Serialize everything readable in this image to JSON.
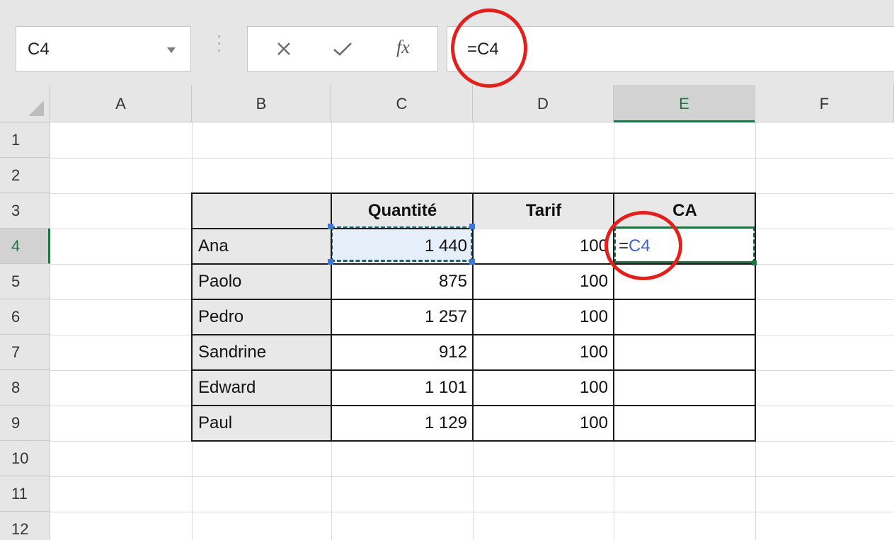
{
  "formula_bar": {
    "name_box": "C4",
    "cancel_icon": "close-icon",
    "enter_icon": "checkmark-icon",
    "function_icon": "fx-icon",
    "function_label": "fx",
    "formula": "=C4"
  },
  "columns": [
    "A",
    "B",
    "C",
    "D",
    "E",
    "F"
  ],
  "selected_column": "E",
  "rows": [
    "1",
    "2",
    "3",
    "4",
    "5",
    "6",
    "7",
    "8",
    "9",
    "10",
    "11",
    "12"
  ],
  "selected_row": "4",
  "table": {
    "headers": [
      "",
      "Quantité",
      "Tarif",
      "CA"
    ],
    "data": [
      {
        "name": "Ana",
        "quantite": "1 440",
        "tarif": "100",
        "ca_prefix": "=",
        "ca_ref": "C4"
      },
      {
        "name": "Paolo",
        "quantite": "875",
        "tarif": "100",
        "ca_prefix": "",
        "ca_ref": ""
      },
      {
        "name": "Pedro",
        "quantite": "1 257",
        "tarif": "100",
        "ca_prefix": "",
        "ca_ref": ""
      },
      {
        "name": "Sandrine",
        "quantite": "912",
        "tarif": "100",
        "ca_prefix": "",
        "ca_ref": ""
      },
      {
        "name": "Edward",
        "quantite": "1 101",
        "tarif": "100",
        "ca_prefix": "",
        "ca_ref": ""
      },
      {
        "name": "Paul",
        "quantite": "1 129",
        "tarif": "100",
        "ca_prefix": "",
        "ca_ref": ""
      }
    ]
  },
  "colors": {
    "excel_green": "#217346",
    "reference_blue": "#3c63c9",
    "annotation_red": "#e2211c",
    "copy_highlight": "#e6eef9"
  }
}
